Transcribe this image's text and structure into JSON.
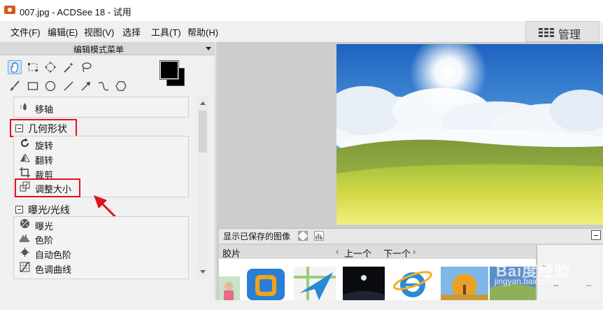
{
  "window": {
    "title": "007.jpg - ACDSee 18 - 试用"
  },
  "menubar": {
    "items": [
      {
        "label": "文件(F)"
      },
      {
        "label": "编辑(E)"
      },
      {
        "label": "视图(V)"
      },
      {
        "label": "选择"
      },
      {
        "label": "工具(T)"
      },
      {
        "label": "帮助(H)"
      }
    ],
    "manage_label": "管理"
  },
  "left_panel": {
    "header": "编辑模式菜单",
    "tools_row1": [
      "hand-icon",
      "marquee-select-icon",
      "transform-icon",
      "magic-wand-icon",
      "lasso-icon"
    ],
    "tools_row2": [
      "brush-icon",
      "rectangle-icon",
      "ellipse-icon",
      "line-icon",
      "arrow-icon",
      "curve-icon",
      "polygon-icon"
    ],
    "colors": {
      "foreground": "#000000",
      "background": "#000000",
      "highlight": "#e0141a"
    },
    "move_axis": "移轴",
    "geometry": {
      "title": "几何形状",
      "items": [
        {
          "label": "旋转"
        },
        {
          "label": "翻转"
        },
        {
          "label": "裁剪"
        },
        {
          "label": "调整大小"
        }
      ]
    },
    "exposure": {
      "title": "曝光/光线",
      "items": [
        {
          "label": "曝光"
        },
        {
          "label": "色阶"
        },
        {
          "label": "自动色阶"
        },
        {
          "label": "色调曲线"
        }
      ]
    }
  },
  "bottom": {
    "show_saved_image": "显示已保存的图像",
    "filmstrip_label": "胶片",
    "prev": "上一个",
    "next": "下一个",
    "info_values": [
      "--",
      "--",
      "--"
    ]
  },
  "watermark": {
    "text": "Bai度经验",
    "url": "jingyan.baidu.com"
  }
}
